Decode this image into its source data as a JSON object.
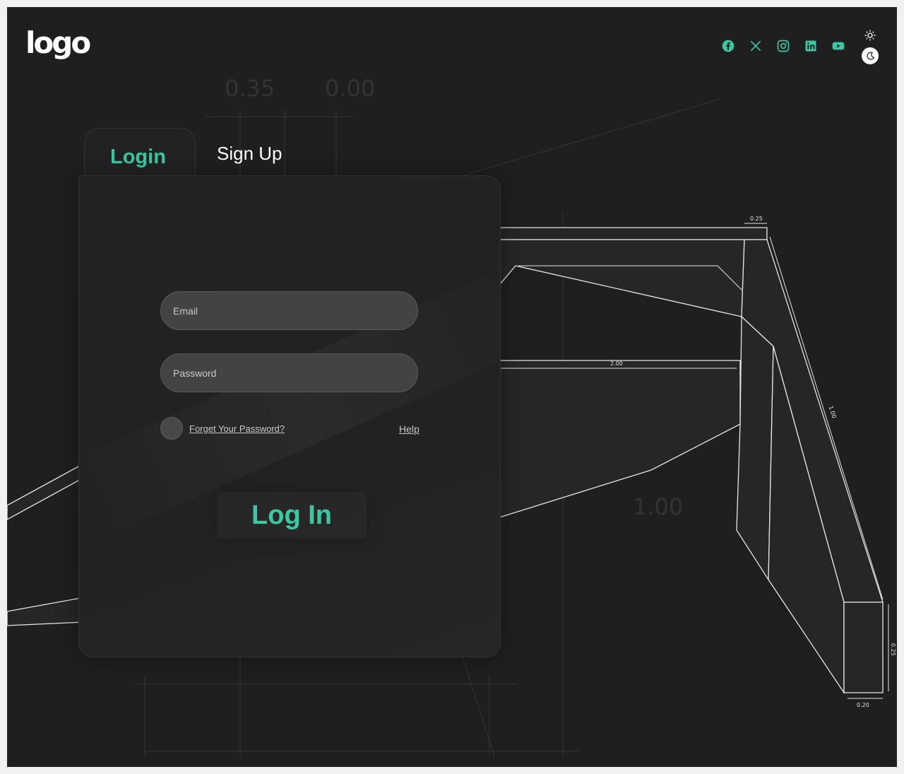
{
  "header": {
    "logo": "logo",
    "social": [
      {
        "name": "facebook-icon"
      },
      {
        "name": "x-icon"
      },
      {
        "name": "instagram-icon"
      },
      {
        "name": "linkedin-icon"
      },
      {
        "name": "youtube-icon"
      }
    ],
    "theme": {
      "light_icon": "sun-icon",
      "dark_icon": "moon-icon",
      "active": "dark"
    }
  },
  "tabs": {
    "login": "Login",
    "signup": "Sign Up",
    "active": "login"
  },
  "form": {
    "email_placeholder": "Email",
    "password_placeholder": "Password",
    "forgot_link": "Forget Your Password?",
    "help_link": "Help",
    "submit_label": "Log In"
  },
  "background": {
    "dimension_labels": [
      "0.25",
      "2.00",
      "1.00",
      "0.20",
      "0.25",
      "1.00",
      "0.35",
      "0.00"
    ]
  },
  "colors": {
    "accent": "#3bc7a4",
    "background": "#1f1f1f",
    "card": "#222222",
    "input": "#434343"
  }
}
